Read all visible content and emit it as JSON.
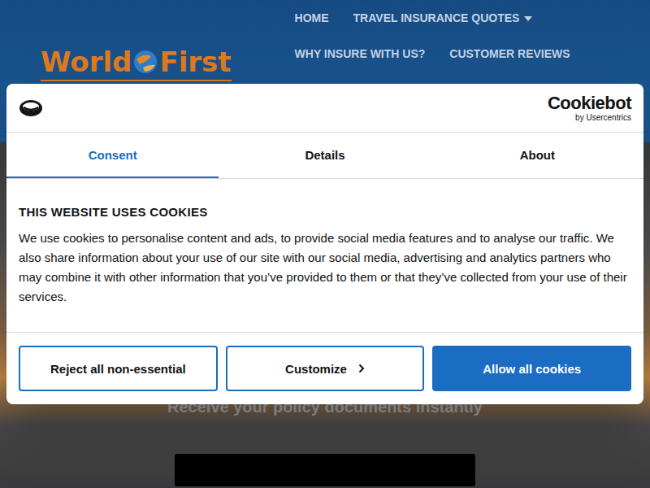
{
  "site": {
    "logo": {
      "left": "World",
      "right": "First"
    },
    "nav": [
      {
        "label": "HOME",
        "dropdown": false
      },
      {
        "label": "TRAVEL INSURANCE QUOTES",
        "dropdown": true
      },
      {
        "label": "WHY INSURE WITH US?",
        "dropdown": false
      },
      {
        "label": "CUSTOMER REVIEWS",
        "dropdown": false
      }
    ],
    "hero_text": "Receive your policy documents instantly"
  },
  "cookie_dialog": {
    "brand": {
      "name": "Cookiebot",
      "sub": "by Usercentrics"
    },
    "tabs": [
      {
        "label": "Consent",
        "selected": true
      },
      {
        "label": "Details",
        "selected": false
      },
      {
        "label": "About",
        "selected": false
      }
    ],
    "title": "THIS WEBSITE USES COOKIES",
    "body": "We use cookies to personalise content and ads, to provide social media features and to analyse our traffic. We also share information about your use of our site with our social media, advertising and analytics partners who may combine it with other information that you’ve provided to them or that they’ve collected from your use of their services.",
    "buttons": [
      {
        "label": "Reject all non-essential",
        "kind": "outline",
        "chevron": false
      },
      {
        "label": "Customize",
        "kind": "outline",
        "chevron": true
      },
      {
        "label": "Allow all cookies",
        "kind": "primary",
        "chevron": false
      }
    ]
  }
}
